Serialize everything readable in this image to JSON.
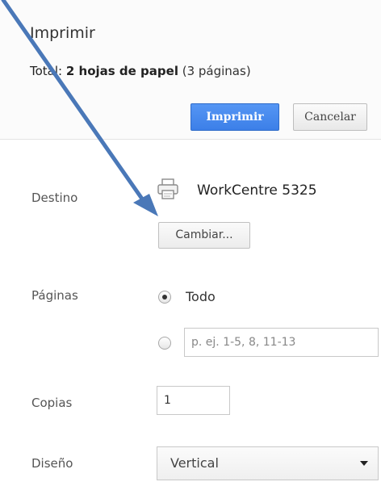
{
  "header": {
    "title": "Imprimir",
    "summary_prefix": "Total: ",
    "summary_bold": "2 hojas de papel",
    "summary_suffix": " (3 páginas)",
    "print_button": "Imprimir",
    "cancel_button": "Cancelar"
  },
  "destination": {
    "label": "Destino",
    "printer_name": "WorkCentre 5325",
    "change_button": "Cambiar..."
  },
  "pages": {
    "label": "Páginas",
    "option_all": "Todo",
    "selected": "all",
    "range_placeholder": "p. ej. 1-5, 8, 11-13"
  },
  "copies": {
    "label": "Copias",
    "value": "1"
  },
  "layout": {
    "label": "Diseño",
    "value": "Vertical"
  },
  "colors": {
    "primary_button": "#3c7fe8",
    "annotation_arrow": "#4a78b8"
  },
  "icons": {
    "printer": "printer-icon",
    "dropdown": "chevron-down-icon",
    "annotation": "arrow-annotation"
  }
}
